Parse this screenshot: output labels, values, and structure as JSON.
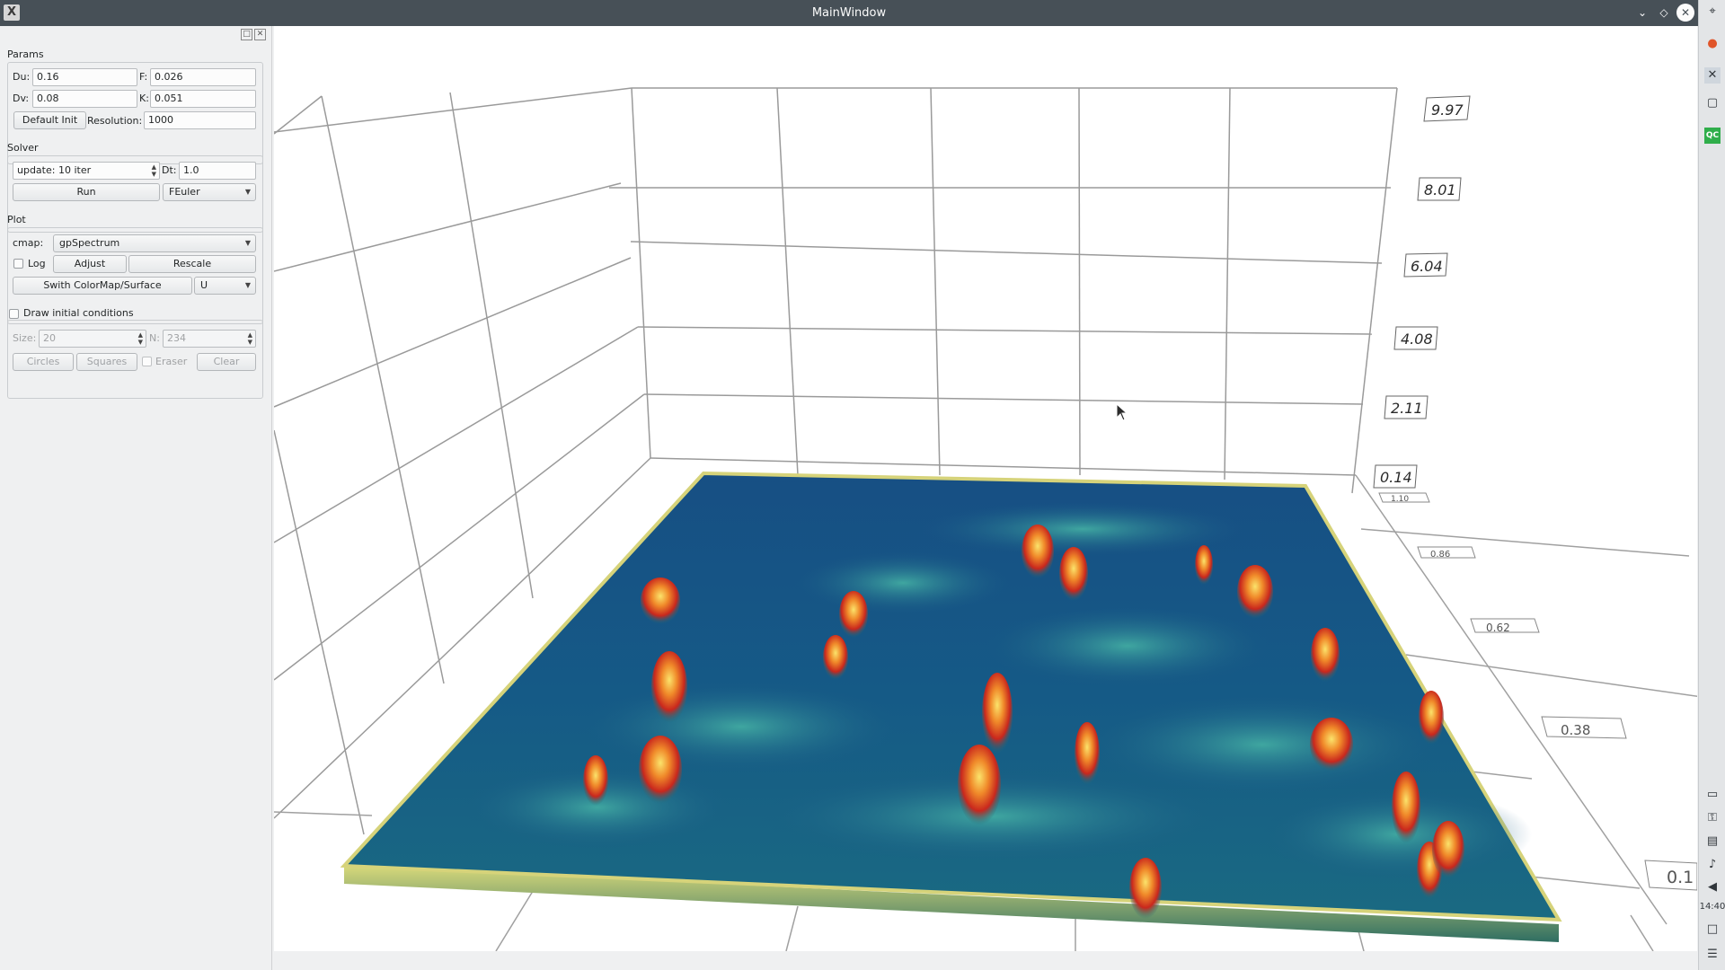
{
  "window": {
    "title": "MainWindow",
    "app_icon_glyph": "X",
    "controls": [
      "chevron-down-icon",
      "diamond-icon",
      "close-icon"
    ]
  },
  "params": {
    "title": "Params",
    "du_label": "Du:",
    "du_value": "0.16",
    "f_label": "F:",
    "f_value": "0.026",
    "dv_label": "Dv:",
    "dv_value": "0.08",
    "k_label": "K:",
    "k_value": "0.051",
    "default_init_label": "Default Init",
    "resolution_label": "Resolution:",
    "resolution_value": "1000"
  },
  "solver": {
    "title": "Solver",
    "update_value": "update: 10 iter",
    "dt_label": "Dt:",
    "dt_value": "1.0",
    "run_label": "Run",
    "method_value": "FEuler"
  },
  "plot": {
    "title": "Plot",
    "cmap_label": "cmap:",
    "cmap_value": "gpSpectrum",
    "log_label": "Log",
    "adjust_label": "Adjust",
    "rescale_label": "Rescale",
    "switch_label": "Swith ColorMap/Surface",
    "field_value": "U"
  },
  "draw": {
    "title": "Draw initial conditions",
    "size_label": "Size:",
    "size_value": "20",
    "n_label": "N:",
    "n_value": "234",
    "circles_label": "Circles",
    "squares_label": "Squares",
    "eraser_label": "Eraser",
    "clear_label": "Clear"
  },
  "axis": {
    "z_ticks": [
      "9.97",
      "8.01",
      "6.04",
      "4.08",
      "2.11",
      "0.14"
    ],
    "y_ticks": [
      "1.10",
      "0.86",
      "0.62",
      "0.38",
      "0.1"
    ]
  },
  "taskbar": {
    "clock": "14:40",
    "icons": [
      "network-icon",
      "firefox-icon",
      "x-app-icon",
      "window-icon",
      "qc-app-icon",
      "display-icon",
      "lock-icon",
      "clipboard-icon",
      "volume-icon",
      "arrow-left-icon",
      "desktop-icon",
      "menu-icon"
    ]
  },
  "colors": {
    "titlebar": "#475057",
    "panel": "#eff0f1",
    "surface_low": "#0f3a73",
    "surface_mid": "#1b7a7f",
    "surface_high": "#cc2a1e",
    "peak_yellow": "#f2c94c"
  }
}
